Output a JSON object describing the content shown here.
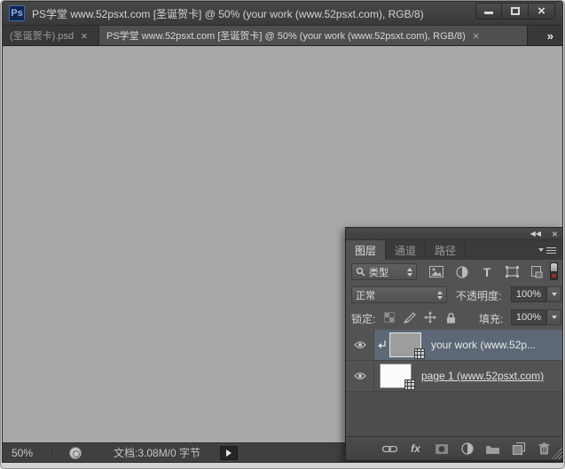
{
  "window": {
    "logo_text": "Ps",
    "title": "PS学堂 www.52psxt.com [圣诞贺卡] @ 50% (your work (www.52psxt.com), RGB/8)"
  },
  "tab_bar": {
    "tabs": [
      {
        "label": "(圣诞贺卡).psd",
        "close_glyph": "×"
      },
      {
        "label": "PS学堂 www.52psxt.com [圣诞贺卡] @ 50% (your work (www.52psxt.com), RGB/8)",
        "close_glyph": "×"
      }
    ],
    "overflow_glyph": "»"
  },
  "status_bar": {
    "zoom_value": "50%",
    "doc_info": "文档:3.08M/0 字节"
  },
  "layers_panel": {
    "collapse_glyph": "◀◀",
    "close_glyph": "×",
    "tabs": [
      {
        "label": "图层"
      },
      {
        "label": "通道"
      },
      {
        "label": "路径"
      }
    ],
    "filter_kind_value": "类型",
    "type_tool_glyph": "T",
    "blend_mode_value": "正常",
    "opacity_label": "不透明度:",
    "opacity_value": "100%",
    "lock_label": "锁定:",
    "fill_label": "填充:",
    "fill_value": "100%",
    "layers": [
      {
        "name": "your work (www.52p..."
      },
      {
        "name": "page 1 (www.52psxt.com)"
      }
    ],
    "fx_glyph": "fx"
  },
  "colors": {
    "canvas_gray": "#a8a8a8",
    "panel_gray": "#535353",
    "selected_layer": "#5c6876",
    "ps_logo_blue": "#12254e",
    "toggle_red": "#9c2a2a"
  }
}
